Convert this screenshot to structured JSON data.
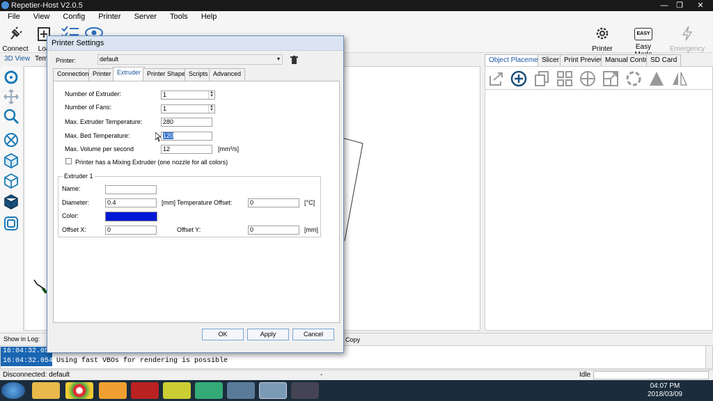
{
  "window": {
    "title": "Repetier-Host V2.0.5"
  },
  "menu": [
    "File",
    "View",
    "Config",
    "Printer",
    "Server",
    "Tools",
    "Help"
  ],
  "toolbar": {
    "connect": "Connect",
    "load": "Loa",
    "printer_settings": "Printer Settings",
    "easy_mode": "Easy Mode",
    "easy_badge": "EASY",
    "emergency_stop": "Emergency Stop"
  },
  "left_tabs": [
    "3D View",
    "Temp"
  ],
  "right_tabs": [
    "Object Placement",
    "Slicer",
    "Print Preview",
    "Manual Control",
    "SD Card"
  ],
  "log": {
    "show_in_log": "Show in Log:",
    "copy": "Copy",
    "rows": [
      {
        "time": "16:04:32.05",
        "message": ""
      },
      {
        "time": "16:04:32.054",
        "message": "Using fast VBOs for rendering is possible"
      }
    ]
  },
  "status": {
    "left": "Disconnected: default",
    "mid": "-",
    "right": "Idle"
  },
  "clock": {
    "time": "04:07 PM",
    "date": "2018/03/09"
  },
  "dialog": {
    "title": "Printer Settings",
    "printer_label": "Printer:",
    "printer_value": "default",
    "tabs": [
      "Connection",
      "Printer",
      "Extruder",
      "Printer Shape",
      "Scripts",
      "Advanced"
    ],
    "fields": {
      "num_extruder_label": "Number of Extruder:",
      "num_extruder_value": "1",
      "num_fans_label": "Number of Fans:",
      "num_fans_value": "1",
      "max_extruder_temp_label": "Max. Extruder Temperature:",
      "max_extruder_temp_value": "280",
      "max_bed_temp_label": "Max. Bed Temperature:",
      "max_bed_temp_value": "120",
      "max_volume_label": "Max. Volume per second",
      "max_volume_value": "12",
      "max_volume_unit": "[mm³/s]",
      "mixing_label": "Printer has a Mixing Extruder (one nozzle for all colors)"
    },
    "extruder": {
      "group_title": "Extruder 1",
      "name_label": "Name:",
      "name_value": "",
      "diameter_label": "Diameter:",
      "diameter_value": "0.4",
      "diameter_unit": "[mm]",
      "temp_offset_label": "Temperature Offset:",
      "temp_offset_value": "0",
      "temp_offset_unit": "[°C]",
      "color_label": "Color:",
      "color_value": "#0019d6",
      "offset_x_label": "Offset X:",
      "offset_x_value": "0",
      "offset_y_label": "Offset Y:",
      "offset_y_value": "0",
      "offset_y_unit": "[mm]"
    },
    "buttons": {
      "ok": "OK",
      "apply": "Apply",
      "cancel": "Cancel"
    }
  }
}
